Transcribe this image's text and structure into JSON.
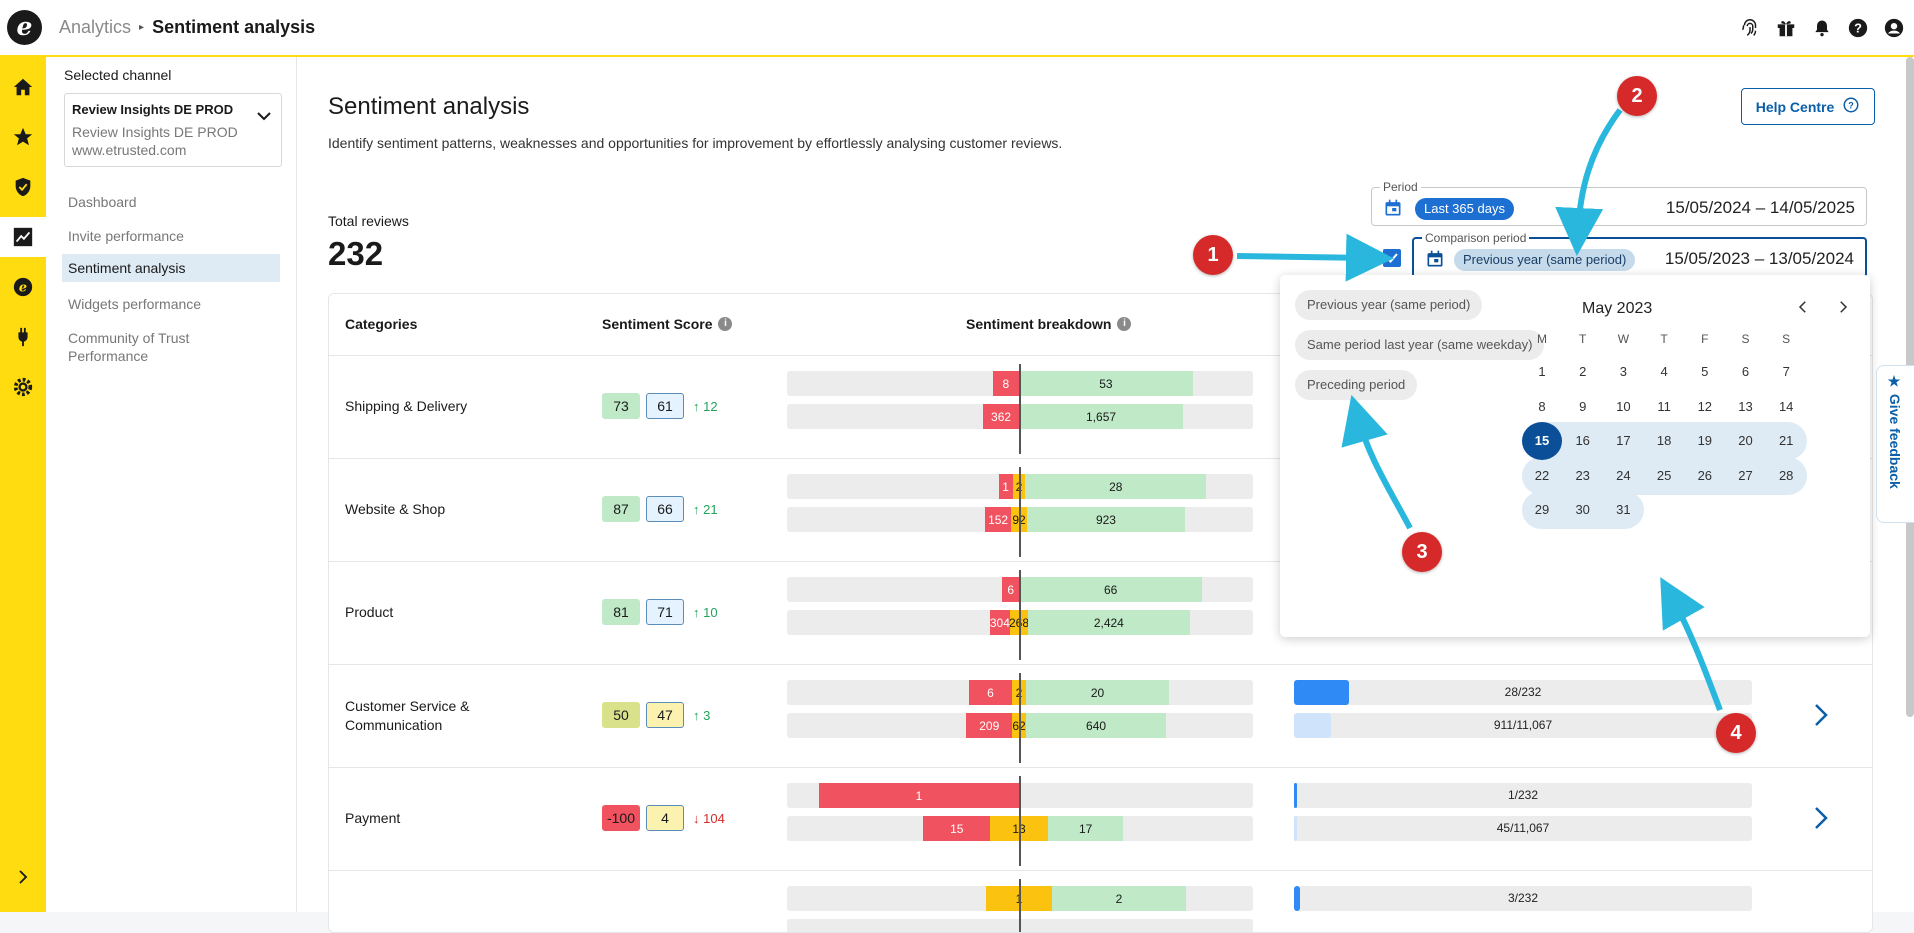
{
  "header": {
    "app": "Analytics",
    "page": "Sentiment analysis",
    "icons": [
      "fingerprint-icon",
      "gift-icon",
      "bell-icon",
      "help-icon",
      "account-icon"
    ]
  },
  "rail": {
    "items": [
      "home-icon",
      "star-icon",
      "shield-icon",
      "analytics-icon",
      "coin-icon",
      "plug-icon",
      "settings-icon"
    ],
    "expand": "chevron-right-icon"
  },
  "sidebar": {
    "selected_label": "Selected channel",
    "channel_name": "Review Insights DE PROD",
    "channel_sub": "Review Insights DE PROD",
    "channel_url": "www.etrusted.com",
    "items": [
      {
        "label": "Dashboard"
      },
      {
        "label": "Invite performance"
      },
      {
        "label": "Sentiment analysis"
      },
      {
        "label": "Widgets performance"
      },
      {
        "label": "Community of Trust Performance"
      }
    ]
  },
  "main": {
    "title": "Sentiment analysis",
    "subtitle": "Identify sentiment patterns, weaknesses and opportunities for improvement by effortlessly analysing customer reviews.",
    "help": "Help Centre",
    "total_label": "Total reviews",
    "total_value": "232",
    "period": {
      "label": "Period",
      "pill": "Last 365 days",
      "range": "15/05/2024 – 14/05/2025"
    },
    "comparison": {
      "label": "Comparison period",
      "pill": "Previous year (same period)",
      "range": "15/05/2023 – 13/05/2024",
      "enabled": true
    },
    "columns": {
      "categories": "Categories",
      "score": "Sentiment Score",
      "breakdown": "Sentiment breakdown"
    }
  },
  "rows": [
    {
      "name": "Shipping & Delivery",
      "s1": "73",
      "s2": "61",
      "delta": "12",
      "dir": "up",
      "c1": "#bfe9c7",
      "c2": "#e4f3ff",
      "b1": {
        "neg": "8",
        "neu": "",
        "pos": "53"
      },
      "b2": {
        "neg": "362",
        "neu": "",
        "pos": "1,657"
      }
    },
    {
      "name": "Website & Shop",
      "s1": "87",
      "s2": "66",
      "delta": "21",
      "dir": "up",
      "c1": "#bfe9c7",
      "c2": "#e4f3ff",
      "b1": {
        "neg": "1",
        "neu": "2",
        "pos": "28"
      },
      "b2": {
        "neg": "152",
        "neu": "92",
        "pos": "923"
      }
    },
    {
      "name": "Product",
      "s1": "81",
      "s2": "71",
      "delta": "10",
      "dir": "up",
      "c1": "#bfe9c7",
      "c2": "#e4f3ff",
      "b1": {
        "neg": "6",
        "neu": "",
        "pos": "66"
      },
      "b2": {
        "neg": "304",
        "neu": "268",
        "pos": "2,424"
      }
    },
    {
      "name": "Customer Service & Communication",
      "s1": "50",
      "s2": "47",
      "delta": "3",
      "dir": "up",
      "c1": "#d9e28a",
      "c2": "#fbf2b0",
      "b1": {
        "neg": "6",
        "neu": "2",
        "pos": "20"
      },
      "b2": {
        "neg": "209",
        "neu": "62",
        "pos": "640"
      },
      "v1": "28/232",
      "v2": "911/11,067",
      "v1f": 0.12,
      "v2f": 0.08
    },
    {
      "name": "Payment",
      "s1": "-100",
      "s2": "4",
      "delta": "104",
      "dir": "down",
      "c1": "#f1525f",
      "c2": "#fbf2b0",
      "b1": {
        "neg": "1",
        "neu": "",
        "pos": ""
      },
      "b2": {
        "neg": "15",
        "neu": "13",
        "pos": "17"
      },
      "v1": "1/232",
      "v2": "45/11,067",
      "v1f": 0.005,
      "v2f": 0.004
    },
    {
      "name": "",
      "s1": "",
      "s2": "",
      "delta": "",
      "dir": "",
      "b1": {
        "neg": "",
        "neu": "1",
        "pos": "2"
      },
      "b2": {
        "neg": "",
        "neu": "",
        "pos": ""
      },
      "v1": "3/232",
      "v2": "",
      "v1f": 0.013,
      "v2f": 0
    }
  ],
  "popup": {
    "options": [
      "Previous year (same period)",
      "Same period last year (same weekday)",
      "Preceding period"
    ],
    "month": "May 2023",
    "dow": [
      "M",
      "T",
      "W",
      "T",
      "F",
      "S",
      "S"
    ],
    "weeks": [
      [
        "1",
        "2",
        "3",
        "4",
        "5",
        "6",
        "7"
      ],
      [
        "8",
        "9",
        "10",
        "11",
        "12",
        "13",
        "14"
      ],
      [
        "15",
        "16",
        "17",
        "18",
        "19",
        "20",
        "21"
      ],
      [
        "22",
        "23",
        "24",
        "25",
        "26",
        "27",
        "28"
      ],
      [
        "29",
        "30",
        "31",
        "",
        "",
        "",
        ""
      ]
    ],
    "selected": "15"
  },
  "feedback": "★ Give feedback",
  "annotations": [
    "1",
    "2",
    "3",
    "4"
  ],
  "colors": {
    "accent": "#ffdc0f",
    "primary": "#0a5fa8",
    "negative": "#f1525f",
    "neutral": "#fbc30f",
    "positive": "#bfe9c7",
    "badge": "#d62a2a",
    "arrow": "#2ab7dd"
  }
}
